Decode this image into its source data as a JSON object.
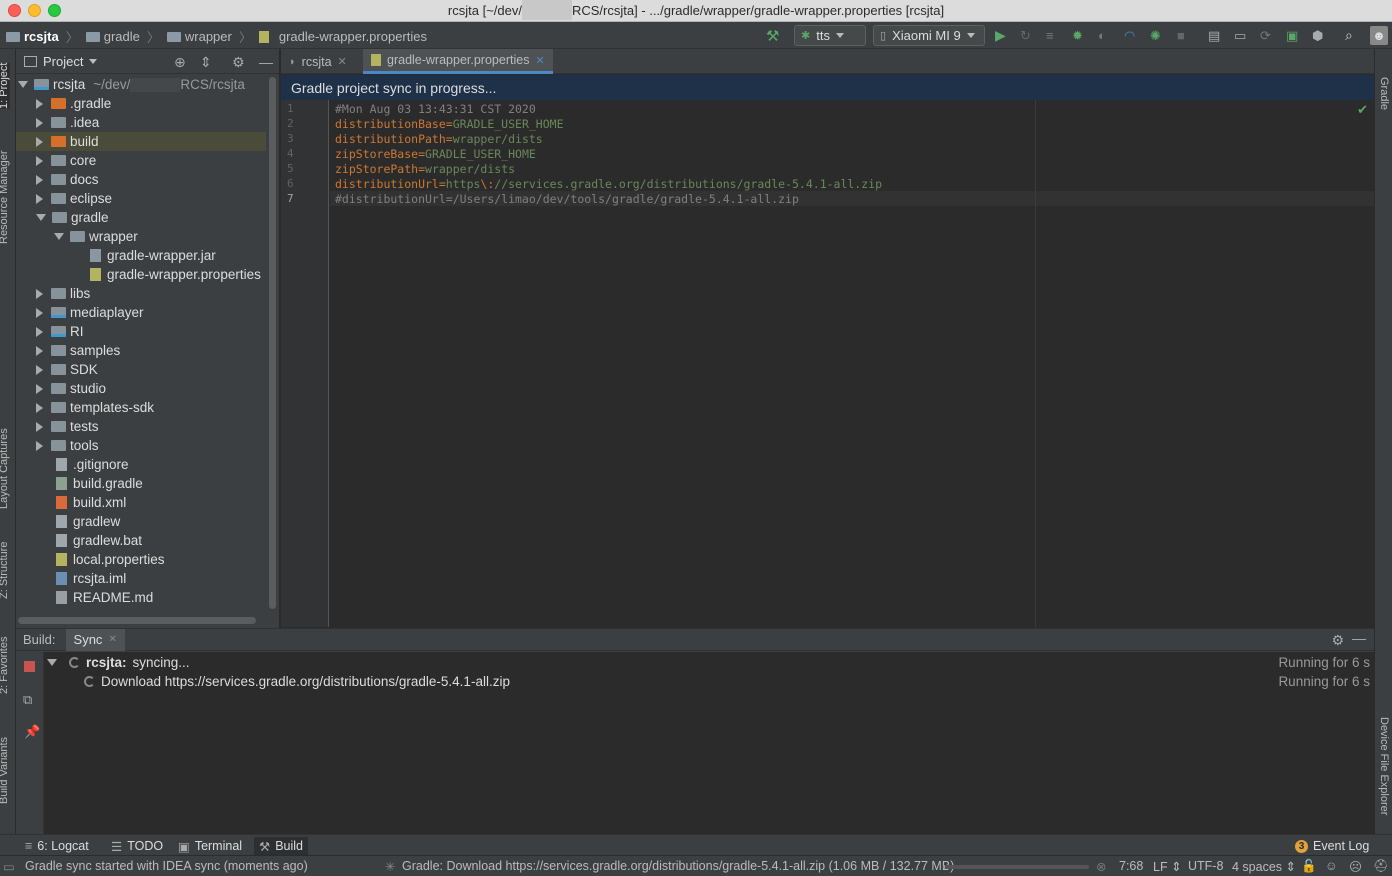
{
  "window": {
    "title_pre": "rcsjta [~/dev/",
    "title_post": "RCS/rcsjta] - .../gradle/wrapper/gradle-wrapper.properties [rcsjta]"
  },
  "nav": {
    "crumb1": "rcsjta",
    "crumb2": "gradle",
    "crumb3": "wrapper",
    "crumb4": "gradle-wrapper.properties"
  },
  "toolbar": {
    "config": "tts",
    "device": "Xiaomi MI 9"
  },
  "left_stripe": {
    "project": "1: Project",
    "resource": "Resource Manager",
    "layout": "Layout Captures",
    "structure": "Z: Structure",
    "favorites": "2: Favorites",
    "variants": "Build Variants"
  },
  "right_stripe": {
    "gradle": "Gradle",
    "device_explorer": "Device File Explorer"
  },
  "project": {
    "header": "Project",
    "root_name": "rcsjta",
    "root_path_pre": "~/dev/",
    "root_path_post": "RCS/rcsjta",
    "items": [
      ".gradle",
      ".idea",
      "build",
      "core",
      "docs",
      "eclipse",
      "gradle",
      "wrapper",
      "gradle-wrapper.jar",
      "gradle-wrapper.properties",
      "libs",
      "mediaplayer",
      "RI",
      "samples",
      "SDK",
      "studio",
      "templates-sdk",
      "tests",
      "tools",
      ".gitignore",
      "build.gradle",
      "build.xml",
      "gradlew",
      "gradlew.bat",
      "local.properties",
      "rcsjta.iml",
      "README.md"
    ]
  },
  "editor": {
    "tabs": [
      "rcsjta",
      "gradle-wrapper.properties"
    ],
    "banner": "Gradle project sync in progress...",
    "line_numbers": [
      "1",
      "2",
      "3",
      "4",
      "5",
      "6",
      "7"
    ],
    "line1": "#Mon Aug 03 13:43:31 CST 2020",
    "line2_key": "distributionBase",
    "line2_val": "GRADLE_USER_HOME",
    "line3_key": "distributionPath",
    "line3_val": "wrapper/dists",
    "line4_key": "zipStoreBase",
    "line4_val": "GRADLE_USER_HOME",
    "line5_key": "zipStorePath",
    "line5_val": "wrapper/dists",
    "line6_key": "distributionUrl",
    "line6_val_a": "https",
    "line6_esc": "\\:",
    "line6_val_b": "//services.gradle.org/distributions/gradle-5.4.1-all.zip",
    "line7": "#distributionUrl=/Users/limao/dev/tools/gradle/gradle-5.4.1-all.zip",
    "eq": "="
  },
  "build": {
    "label": "Build:",
    "tab": "Sync",
    "row1_name": "rcsjta:",
    "row1_status": "syncing...",
    "row1_time": "Running for 6 s",
    "row2": "Download https://services.gradle.org/distributions/gradle-5.4.1-all.zip",
    "row2_time": "Running for 6 s"
  },
  "bottom_tools": {
    "logcat": "6: Logcat",
    "todo": "TODO",
    "terminal": "Terminal",
    "build": "Build",
    "event_log": "Event Log",
    "event_count": "3"
  },
  "status": {
    "left": "Gradle sync started with IDEA sync (moments ago)",
    "task": "Gradle: Download https://services.gradle.org/distributions/gradle-5.4.1-all.zip  (1.06 MB / 132.77 MB)",
    "progress_fraction": 0.008,
    "position": "7:68",
    "line_sep": "LF",
    "encoding": "UTF-8",
    "indent": "4 spaces"
  }
}
